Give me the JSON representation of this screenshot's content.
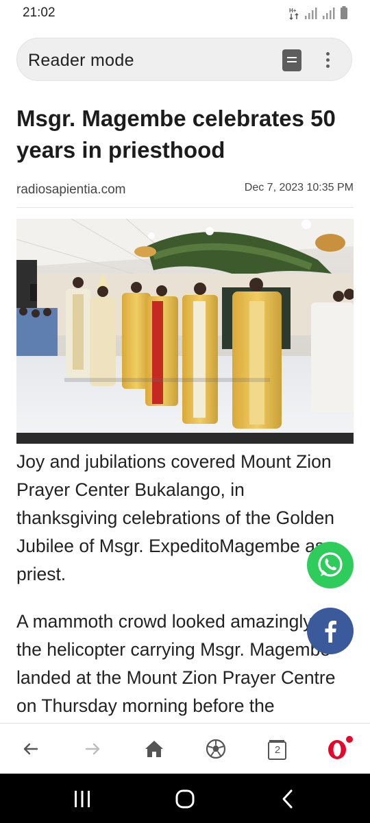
{
  "status_bar": {
    "time": "21:02"
  },
  "browser": {
    "address_label": "Reader mode"
  },
  "article": {
    "title": "Msgr. Magembe celebrates 50 years in priesthood",
    "source": "radiosapientia.com",
    "date": "Dec 7, 2023 10:35 PM",
    "paragraphs": [
      "Joy and jubilations covered Mount Zion Prayer Center Bukalango, in thanksgiving celebrations of the Golden Jubilee of Msgr. ExpeditoMagembe as a priest.",
      "A mammoth crowd looked amazingly as the helicopter carrying Msgr. Magembe landed at the Mount Zion Prayer Centre on Thursday morning before the"
    ]
  },
  "share": {
    "whatsapp_icon": "whatsapp-icon",
    "facebook_icon": "facebook-icon"
  },
  "toolbar": {
    "tab_count": "2"
  },
  "colors": {
    "whatsapp": "#2ecc5a",
    "facebook": "#3a5a9c",
    "opera_red": "#e4062b"
  }
}
